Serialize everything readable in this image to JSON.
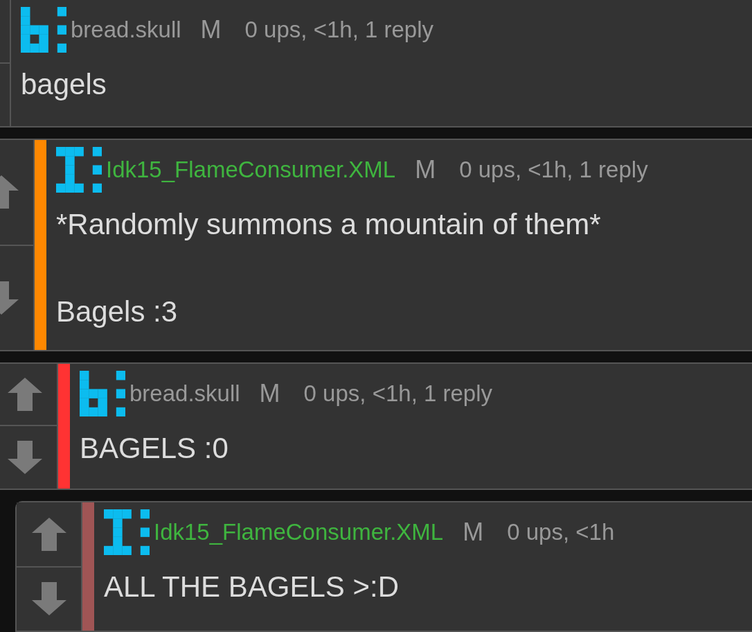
{
  "comments": [
    {
      "kind": "letterb",
      "author": "bread.skull",
      "op": false,
      "badge": "M",
      "meta": "0 ups, <1h, 1 reply",
      "text": "bagels",
      "children": [
        {
          "kind": "letteri",
          "author": "Idk15_FlameConsumer.XML",
          "op": true,
          "badge": "M",
          "meta": "0 ups, <1h, 1 reply",
          "color": "#ff8800",
          "text": "*Randomly summons a mountain of them*\n\nBagels :3",
          "children": [
            {
              "kind": "letterb",
              "author": "bread.skull",
              "op": false,
              "badge": "M",
              "meta": "0 ups, <1h, 1 reply",
              "color": "#ff3333",
              "text": "BAGELS :0",
              "children": [
                {
                  "kind": "letteri",
                  "author": "Idk15_FlameConsumer.XML",
                  "op": true,
                  "badge": "M",
                  "meta": "0 ups, <1h",
                  "color": "#a05555",
                  "text": "ALL THE BAGELS >:D"
                }
              ]
            }
          ]
        }
      ]
    }
  ]
}
